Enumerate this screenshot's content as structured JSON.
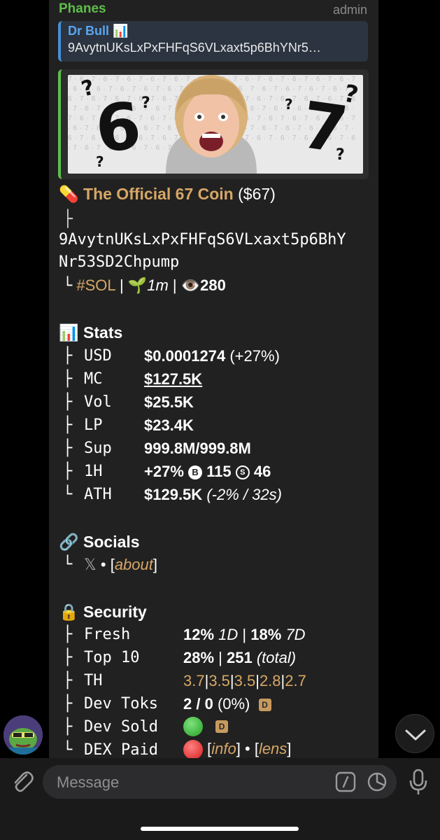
{
  "message": {
    "sender": "Phanes",
    "role": "admin",
    "reply": {
      "name": "Dr Bull 📊",
      "text": "9AvytnUKsLxPxFHFqS6VLxaxt5p6BhYNr5…"
    },
    "banner": {
      "left_digit": "6",
      "right_digit": "7"
    },
    "token": {
      "pill_icon": "💊",
      "name": "The Official 67 Coin",
      "ticker": "($67)",
      "branch": "├",
      "address_line1": "9AvytnUKsLxPxFHFqS6VLxaxt5p6BhY",
      "address_line2": "Nr53SD2Chpump",
      "last_branch": "└",
      "chain": "#SOL",
      "sep": "|",
      "sprout": "🌱",
      "age": "1m",
      "eye": "👁️",
      "views": "280"
    },
    "stats": {
      "icon": "📊",
      "title": "Stats",
      "rows": [
        {
          "tree": "├",
          "label": "USD",
          "value": "$0.0001274",
          "extra": "(+27%)"
        },
        {
          "tree": "├",
          "label": "MC",
          "value": "$127.5K"
        },
        {
          "tree": "├",
          "label": "Vol",
          "value": "$25.5K"
        },
        {
          "tree": "├",
          "label": "LP",
          "value": "$23.4K"
        },
        {
          "tree": "├",
          "label": "Sup",
          "value": "999.8M/999.8M"
        },
        {
          "tree": "├",
          "label": "1H",
          "value": "+27%",
          "b_icon": "B",
          "b_value": "115",
          "s_icon": "S",
          "s_value": "46"
        },
        {
          "tree": "└",
          "label": "ATH",
          "value": "$129.5K",
          "extra": "(-2% / 32s)"
        }
      ]
    },
    "socials": {
      "icon": "🔗",
      "title": "Socials",
      "tree": "└",
      "x": "𝕏",
      "bullet": "•",
      "lb": "[",
      "about": "about",
      "rb": "]"
    },
    "security": {
      "icon": "🔒",
      "title": "Security",
      "fresh": {
        "tree": "├",
        "label": "Fresh",
        "v1": "12%",
        "p1": "1D",
        "sep": "|",
        "v2": "18%",
        "p2": "7D"
      },
      "top10": {
        "tree": "├",
        "label": "Top 10",
        "v1": "28%",
        "sep": "|",
        "v2": "251",
        "note": "(total)"
      },
      "th": {
        "tree": "├",
        "label": "TH",
        "values": [
          "3.7",
          "3.5",
          "3.5",
          "2.8",
          "2.7"
        ],
        "sep": "|"
      },
      "dev_toks": {
        "tree": "├",
        "label": "Dev Toks",
        "value": "2 / 0",
        "pct": "(0%)",
        "badge": "D"
      },
      "dev_sold": {
        "tree": "├",
        "label": "Dev Sold",
        "badge": "D",
        "status_color": "#2fbf2f"
      },
      "dex_paid": {
        "tree": "└",
        "label": "DEX Paid",
        "status_color": "#e02626",
        "lb": "[",
        "info": "info",
        "rb": "]",
        "bullet": "•",
        "lens": "lens"
      }
    }
  },
  "input": {
    "placeholder": "Message"
  },
  "colors": {
    "bubble": "#212121",
    "sender": "#5dbf4b",
    "gold": "#d7a766",
    "reply_accent": "#4a8fd4"
  }
}
